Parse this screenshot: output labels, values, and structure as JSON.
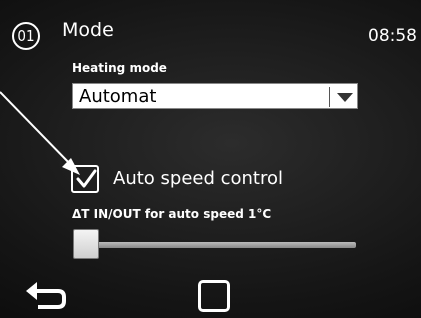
{
  "header": {
    "screen_number": "01",
    "title": "Mode",
    "time": "08:58"
  },
  "heating_mode": {
    "label": "Heating mode",
    "selected": "Automat"
  },
  "auto_speed": {
    "label": "Auto speed control",
    "checked": true
  },
  "delta_t": {
    "label": "ΔT IN/OUT for auto speed  1°C",
    "slider_fraction": 0.0
  },
  "footer": {
    "back_icon": "back-arrow-icon",
    "home_icon": "square-icon"
  },
  "colors": {
    "background": "#000000",
    "text": "#ffffff",
    "dropdown_bg": "#ffffff"
  }
}
